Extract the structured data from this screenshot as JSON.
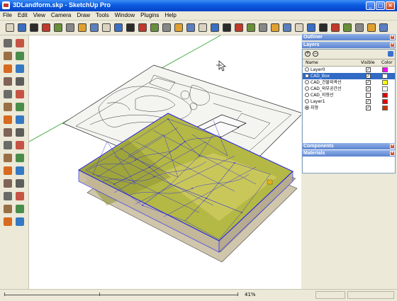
{
  "window": {
    "title": "3DLandform.skp - SketchUp Pro"
  },
  "menu": [
    "File",
    "Edit",
    "View",
    "Camera",
    "Draw",
    "Tools",
    "Window",
    "Plugins",
    "Help"
  ],
  "toolbar_icons": [
    "new-icon",
    "open-icon",
    "save-icon",
    "cut-icon",
    "copy-icon",
    "paste-icon",
    "erase-icon",
    "undo-icon",
    "redo-icon",
    "print-icon",
    "geolocation-icon",
    "components-icon",
    "materials-icon",
    "iso-view-icon",
    "top-view-icon",
    "front-view-icon",
    "right-view-icon",
    "back-view-icon",
    "left-view-icon",
    "xray-icon",
    "wireframe-icon",
    "hidden-line-icon",
    "shaded-icon",
    "shaded-texture-icon",
    "monochrome-icon",
    "sandbox-from-contours-icon",
    "sandbox-from-scratch-icon",
    "smoove-icon",
    "stamp-icon",
    "drape-icon",
    "add-detail-icon",
    "flip-edge-icon"
  ],
  "left_tools": [
    "select-icon",
    "eraser-icon",
    "paint-bucket-icon",
    "line-icon",
    "rectangle-icon",
    "arc-icon",
    "circle-icon",
    "polygon-icon",
    "move-icon",
    "push-pull-icon",
    "rotate-icon",
    "follow-me-icon",
    "scale-icon",
    "offset-icon",
    "tape-measure-icon",
    "dimension-icon",
    "protractor-icon",
    "text-icon",
    "axes-icon",
    "3d-text-icon",
    "orbit-icon",
    "pan-icon",
    "zoom-icon",
    "zoom-window-icon",
    "zoom-extents-icon",
    "previous-view-icon",
    "position-camera-icon",
    "look-around-icon",
    "walk-icon",
    "section-plane-icon"
  ],
  "panels": {
    "outliner": "Outliner",
    "layers": "Layers",
    "components": "Components",
    "materials": "Materials"
  },
  "layers": {
    "columns": {
      "name": "Name",
      "visible": "Visible",
      "color": "Color"
    },
    "rows": [
      {
        "name": "Layer0",
        "visible": true,
        "color": "#ff00ff",
        "active": false,
        "selected": false
      },
      {
        "name": "CAD_Box",
        "visible": true,
        "color": "#ffffff",
        "active": false,
        "selected": true
      },
      {
        "name": "CAD_건물외곽선",
        "visible": true,
        "color": "#ffff00",
        "active": false,
        "selected": false
      },
      {
        "name": "CAD_외부공간선",
        "visible": true,
        "color": "#ffffff",
        "active": false,
        "selected": false
      },
      {
        "name": "CAD_지형선",
        "visible": false,
        "color": "#e00000",
        "active": false,
        "selected": false
      },
      {
        "name": "Layer1",
        "visible": true,
        "color": "#e00000",
        "active": false,
        "selected": false
      },
      {
        "name": "지형",
        "visible": true,
        "color": "#cc3300",
        "active": true,
        "selected": false
      }
    ]
  },
  "status": {
    "zoom": "41%"
  }
}
